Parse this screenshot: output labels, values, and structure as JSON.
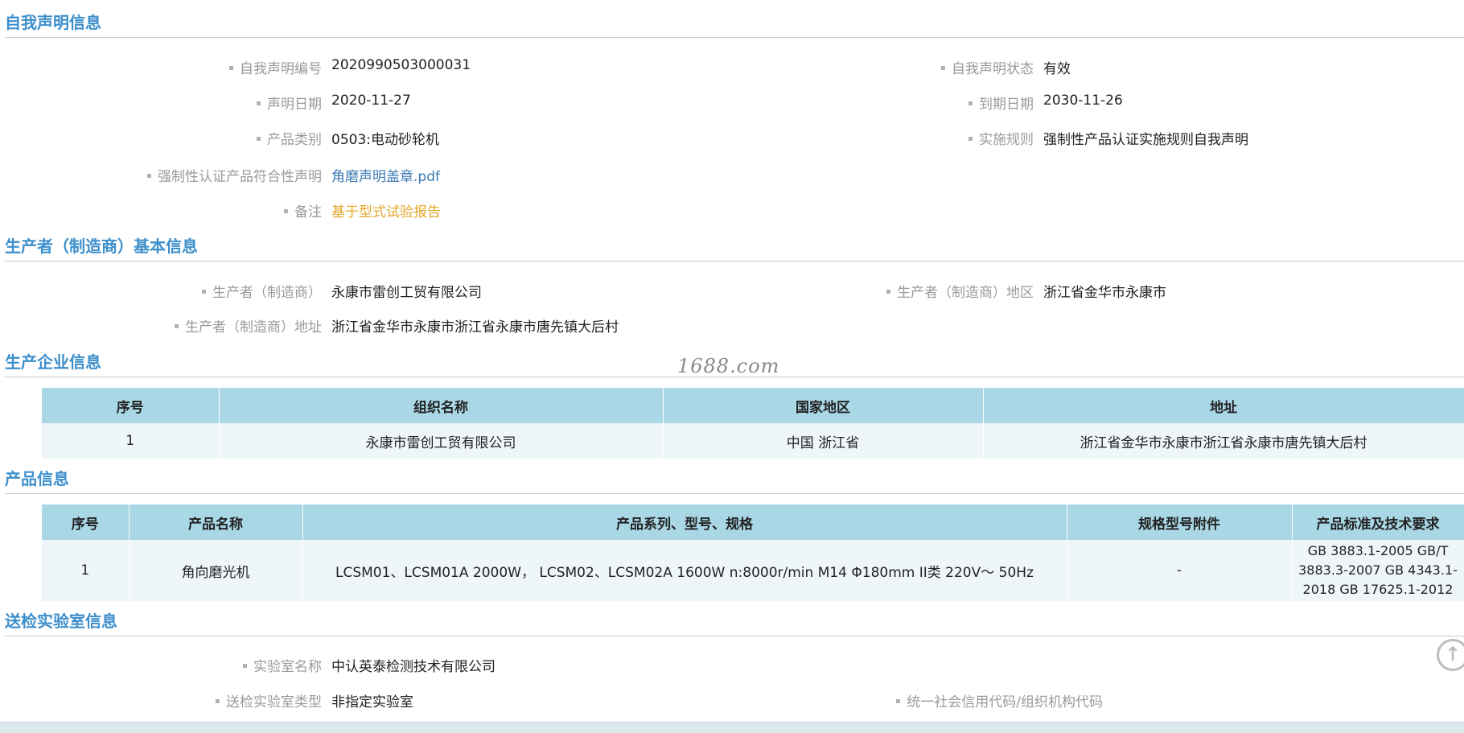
{
  "sections": {
    "declaration": {
      "title": "自我声明信息",
      "fields": [
        {
          "label": "自我声明编号",
          "value": "2020990503000031"
        },
        {
          "label": "自我声明状态",
          "value": "有效"
        },
        {
          "label": "声明日期",
          "value": "2020-11-27"
        },
        {
          "label": "到期日期",
          "value": "2030-11-26"
        },
        {
          "label": "产品类别",
          "value": "0503:电动砂轮机"
        },
        {
          "label": "实施规则",
          "value": "强制性产品认证实施规则自我声明"
        },
        {
          "label": "强制性认证产品符合性声明",
          "value": "角磨声明盖章.pdf"
        },
        {
          "label": "备注",
          "value": "基于型式试验报告"
        }
      ]
    },
    "manufacturer": {
      "title": "生产者（制造商）基本信息",
      "fields": [
        {
          "label": "生产者（制造商）",
          "value": "永康市雷创工贸有限公司"
        },
        {
          "label": "生产者（制造商）地区",
          "value": "浙江省金华市永康市"
        },
        {
          "label": "生产者（制造商）地址",
          "value": "浙江省金华市永康市浙江省永康市唐先镇大后村"
        }
      ]
    },
    "factory": {
      "title": "生产企业信息",
      "columns": [
        "序号",
        "组织名称",
        "国家地区",
        "地址"
      ],
      "rows": [
        [
          "1",
          "永康市雷创工贸有限公司",
          "中国 浙江省",
          "浙江省金华市永康市浙江省永康市唐先镇大后村"
        ]
      ]
    },
    "product": {
      "title": "产品信息",
      "columns": [
        "序号",
        "产品名称",
        "产品系列、型号、规格",
        "规格型号附件",
        "产品标准及技术要求"
      ],
      "rows": [
        [
          "1",
          "角向磨光机",
          "LCSM01、LCSM01A 2000W， LCSM02、LCSM02A 1600W n:8000r/min M14 Φ180mm II类 220V～ 50Hz",
          "-",
          "GB 3883.1-2005 GB/T 3883.3-2007 GB 4343.1-2018 GB 17625.1-2012"
        ]
      ]
    },
    "lab": {
      "title": "送检实验室信息",
      "fields": [
        {
          "label": "实验室名称",
          "value": "中认英泰检测技术有限公司"
        },
        {
          "label": "送检实验室类型",
          "value": "非指定实验室"
        },
        {
          "label": "统一社会信用代码/组织机构代码",
          "value": ""
        }
      ]
    }
  },
  "watermark": "1688.com",
  "icons": {
    "scroll_top": "arrow-up-circle-icon"
  },
  "colors": {
    "section_title": "#3d8fcc",
    "table_header": "#a9d7e6",
    "table_row": "#eef6f9",
    "link": "#3c78b4",
    "note": "#e3a728"
  }
}
